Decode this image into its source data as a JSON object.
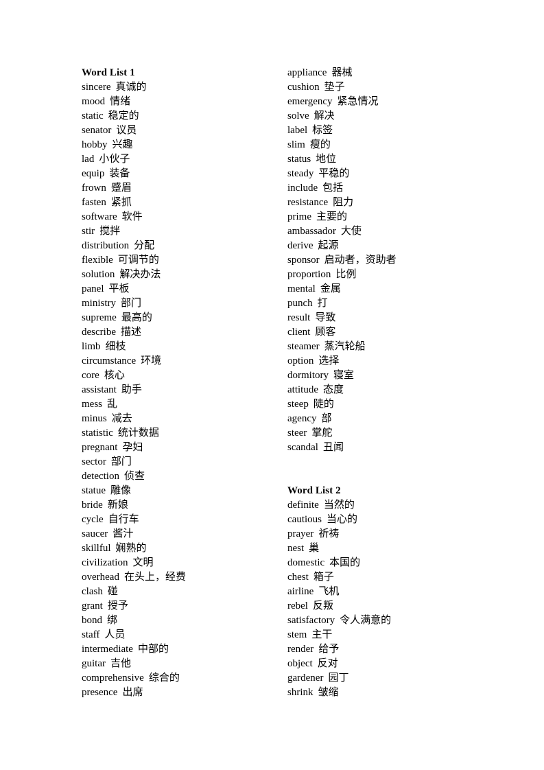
{
  "document": {
    "title": "Word List",
    "page_background": "#ffffff",
    "text_color": "#000000"
  },
  "columns": [
    {
      "name": "left-column",
      "blocks": [
        {
          "type": "heading",
          "text": "Word List 1"
        },
        {
          "type": "entries",
          "entries": [
            {
              "term": "sincere",
              "gloss": "真诚的"
            },
            {
              "term": "mood",
              "gloss": "情绪"
            },
            {
              "term": "static",
              "gloss": "稳定的"
            },
            {
              "term": "senator",
              "gloss": "议员"
            },
            {
              "term": "hobby",
              "gloss": "兴趣"
            },
            {
              "term": "lad",
              "gloss": "小伙子"
            },
            {
              "term": "equip",
              "gloss": "装备"
            },
            {
              "term": "frown",
              "gloss": "蹙眉"
            },
            {
              "term": "fasten",
              "gloss": "紧抓"
            },
            {
              "term": "software",
              "gloss": "软件"
            },
            {
              "term": "stir",
              "gloss": "搅拌"
            },
            {
              "term": "distribution",
              "gloss": "分配"
            },
            {
              "term": "flexible",
              "gloss": "可调节的"
            },
            {
              "term": "solution",
              "gloss": "解决办法"
            },
            {
              "term": "panel",
              "gloss": "平板"
            },
            {
              "term": "ministry",
              "gloss": "部门"
            },
            {
              "term": "supreme",
              "gloss": "最高的"
            },
            {
              "term": "describe",
              "gloss": "描述"
            },
            {
              "term": "limb",
              "gloss": "细枝"
            },
            {
              "term": "circumstance",
              "gloss": "环境"
            },
            {
              "term": "core",
              "gloss": "核心"
            },
            {
              "term": "assistant",
              "gloss": "助手"
            },
            {
              "term": "mess",
              "gloss": "乱"
            },
            {
              "term": "minus",
              "gloss": "减去"
            },
            {
              "term": "statistic",
              "gloss": "统计数据"
            },
            {
              "term": "pregnant",
              "gloss": "孕妇"
            },
            {
              "term": "sector",
              "gloss": "部门"
            },
            {
              "term": "detection",
              "gloss": "侦查"
            },
            {
              "term": "statue",
              "gloss": "雕像"
            },
            {
              "term": "bride",
              "gloss": "新娘"
            },
            {
              "term": "cycle",
              "gloss": "自行车"
            },
            {
              "term": "saucer",
              "gloss": "酱汁"
            },
            {
              "term": "skillful",
              "gloss": "娴熟的"
            },
            {
              "term": "civilization",
              "gloss": "文明"
            },
            {
              "term": "overhead",
              "gloss": "在头上，经费"
            },
            {
              "term": "clash",
              "gloss": "碰"
            },
            {
              "term": "grant",
              "gloss": "授予"
            },
            {
              "term": "bond",
              "gloss": "绑"
            },
            {
              "term": "staff",
              "gloss": "人员"
            },
            {
              "term": "intermediate",
              "gloss": "中部的"
            },
            {
              "term": "guitar",
              "gloss": "吉他"
            },
            {
              "term": "comprehensive",
              "gloss": "综合的"
            },
            {
              "term": "presence",
              "gloss": "出席"
            }
          ]
        }
      ]
    },
    {
      "name": "right-column",
      "blocks": [
        {
          "type": "entries",
          "entries": [
            {
              "term": "appliance",
              "gloss": "器械"
            },
            {
              "term": "cushion",
              "gloss": "垫子"
            },
            {
              "term": "emergency",
              "gloss": "紧急情况"
            },
            {
              "term": "solve",
              "gloss": "解决"
            },
            {
              "term": "label",
              "gloss": "标签"
            },
            {
              "term": "slim",
              "gloss": "瘦的"
            },
            {
              "term": "status",
              "gloss": "地位"
            },
            {
              "term": "steady",
              "gloss": "平稳的"
            },
            {
              "term": "include",
              "gloss": "包括"
            },
            {
              "term": "resistance",
              "gloss": "阻力"
            },
            {
              "term": "prime",
              "gloss": "主要的"
            },
            {
              "term": "ambassador",
              "gloss": "大使"
            },
            {
              "term": "derive",
              "gloss": "起源"
            },
            {
              "term": "sponsor",
              "gloss": "启动者，资助者"
            },
            {
              "term": "proportion",
              "gloss": "比例"
            },
            {
              "term": "mental",
              "gloss": "金属"
            },
            {
              "term": "punch",
              "gloss": "打"
            },
            {
              "term": "result",
              "gloss": "导致"
            },
            {
              "term": "client",
              "gloss": "顾客"
            },
            {
              "term": "steamer",
              "gloss": "蒸汽轮船"
            },
            {
              "term": "option",
              "gloss": "选择"
            },
            {
              "term": "dormitory",
              "gloss": "寝室"
            },
            {
              "term": "attitude",
              "gloss": "态度"
            },
            {
              "term": "steep",
              "gloss": "陡的"
            },
            {
              "term": "agency",
              "gloss": "部"
            },
            {
              "term": "steer",
              "gloss": "掌舵"
            },
            {
              "term": "scandal",
              "gloss": "丑闻"
            }
          ]
        },
        {
          "type": "gap",
          "lines": 2
        },
        {
          "type": "heading",
          "text": "Word List 2"
        },
        {
          "type": "entries",
          "entries": [
            {
              "term": "definite",
              "gloss": "当然的"
            },
            {
              "term": "cautious",
              "gloss": "当心的"
            },
            {
              "term": "prayer",
              "gloss": "祈祷"
            },
            {
              "term": "nest",
              "gloss": "巢"
            },
            {
              "term": "domestic",
              "gloss": "本国的"
            },
            {
              "term": "chest",
              "gloss": "箱子"
            },
            {
              "term": "airline",
              "gloss": "飞机"
            },
            {
              "term": "rebel",
              "gloss": "反叛"
            },
            {
              "term": "satisfactory",
              "gloss": "令人满意的"
            },
            {
              "term": "stem",
              "gloss": "主干"
            },
            {
              "term": "render",
              "gloss": "给予"
            },
            {
              "term": "object",
              "gloss": "反对"
            },
            {
              "term": "gardener",
              "gloss": "园丁"
            },
            {
              "term": "shrink",
              "gloss": "皱缩"
            }
          ]
        }
      ]
    }
  ]
}
